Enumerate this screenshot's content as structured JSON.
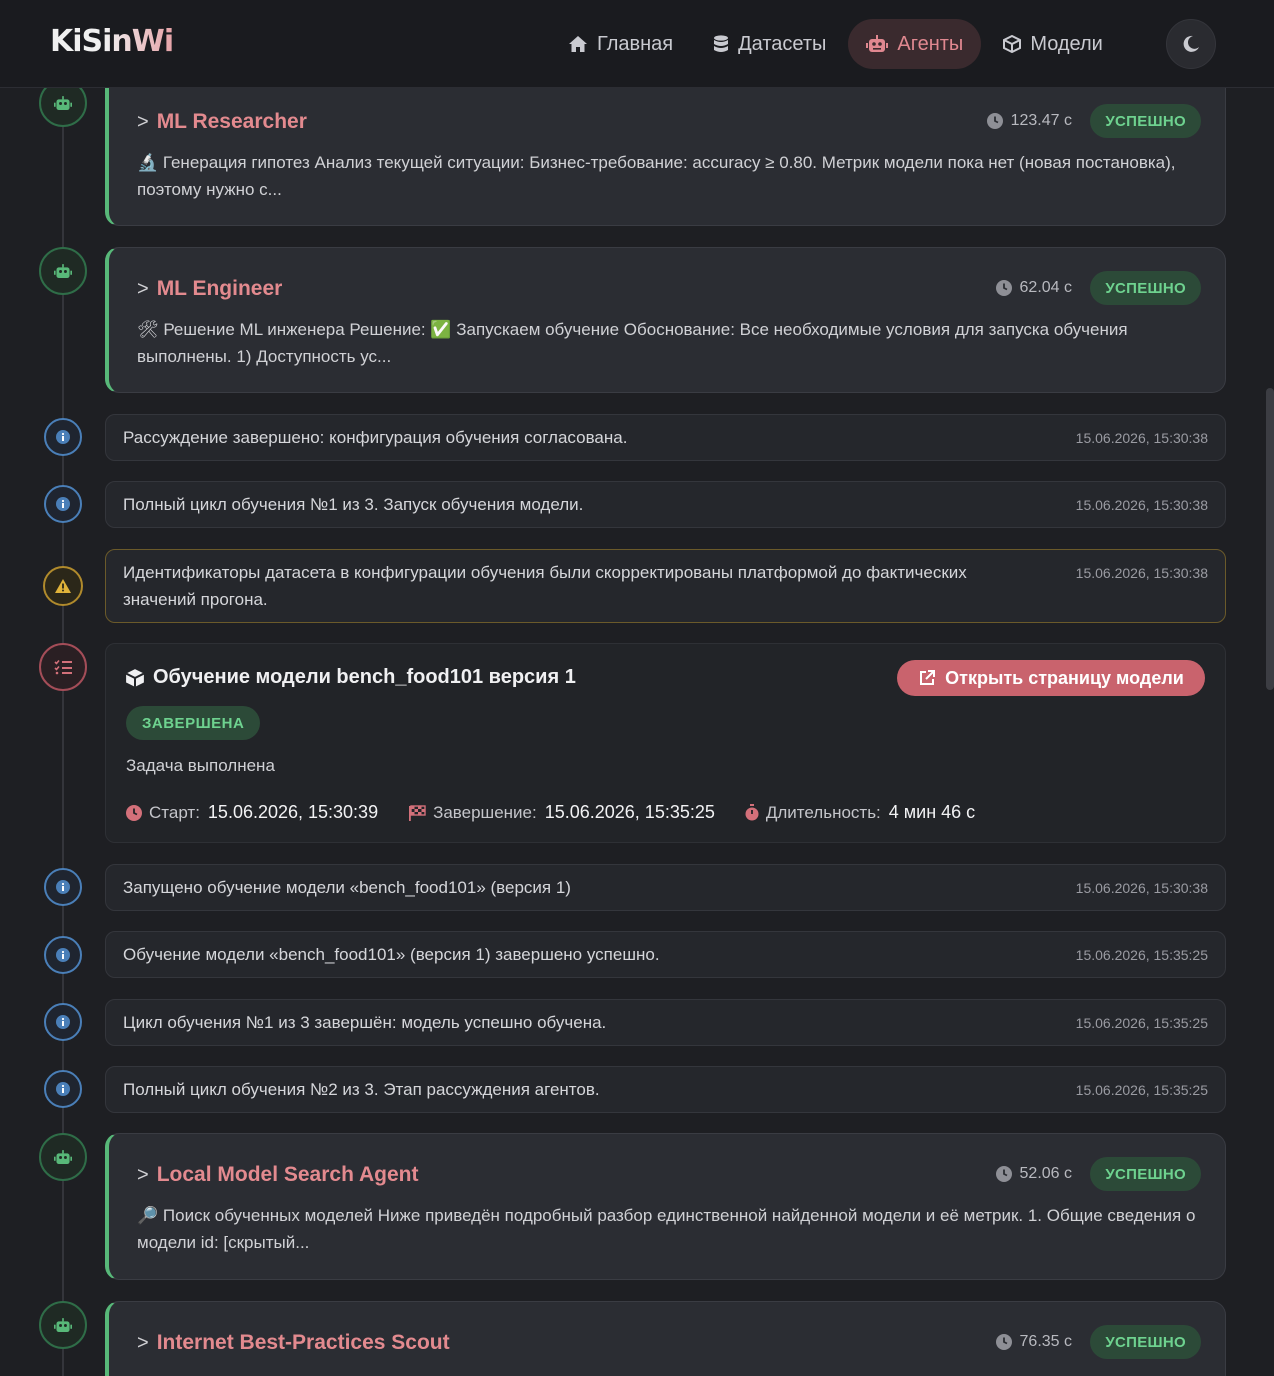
{
  "header": {
    "logo": "KiSinWi",
    "nav": [
      {
        "label": "Главная",
        "icon": "home-icon"
      },
      {
        "label": "Датасеты",
        "icon": "database-icon"
      },
      {
        "label": "Агенты",
        "icon": "robot-icon",
        "active": true
      },
      {
        "label": "Модели",
        "icon": "cube-icon"
      }
    ],
    "theme_icon": "moon-icon"
  },
  "timeline": {
    "agents": [
      {
        "name": "ML Researcher",
        "time": "123.47 с",
        "status": "УСПЕШНО",
        "emoji": "🔬",
        "desc": "Генерация гипотез Анализ текущей ситуации: Бизнес-требование: accuracy ≥ 0.80. Метрик модели пока нет (новая постановка), поэтому нужно с..."
      },
      {
        "name": "ML Engineer",
        "time": "62.04 с",
        "status": "УСПЕШНО",
        "emoji": "🛠",
        "desc": "Решение ML инженера Решение: ✅ Запускаем обучение Обоснование: Все необходимые условия для запуска обучения выполнены. 1) Доступность ус..."
      },
      {
        "name": "Local Model Search Agent",
        "time": "52.06 с",
        "status": "УСПЕШНО",
        "emoji": "🔎",
        "desc": "Поиск обученных моделей Ниже приведён подробный разбор единственной найденной модели и её метрик. 1. Общие сведения о модели id: [скрытый..."
      },
      {
        "name": "Internet Best-Practices Scout",
        "time": "76.35 с",
        "status": "УСПЕШНО"
      }
    ],
    "logs": [
      {
        "text": "Рассуждение завершено: конфигурация обучения согласована.",
        "date": "15.06.2026, 15:30:38"
      },
      {
        "text": "Полный цикл обучения №1 из 3. Запуск обучения модели.",
        "date": "15.06.2026, 15:30:38"
      },
      {
        "text": "Идентификаторы датасета в конфигурации обучения были скорректированы платформой до фактических значений прогона.",
        "date": "15.06.2026, 15:30:38"
      },
      {
        "text": "Запущено обучение модели «bench_food101» (версия 1)",
        "date": "15.06.2026, 15:30:38"
      },
      {
        "text": "Обучение модели «bench_food101» (версия 1) завершено успешно.",
        "date": "15.06.2026, 15:35:25"
      },
      {
        "text": "Цикл обучения №1 из 3 завершён: модель успешно обучена.",
        "date": "15.06.2026, 15:35:25"
      },
      {
        "text": "Полный цикл обучения №2 из 3. Этап рассуждения агентов.",
        "date": "15.06.2026, 15:35:25"
      }
    ],
    "task": {
      "title": "Обучение модели bench_food101 версия 1",
      "open_button": "Открыть страницу модели",
      "status": "ЗАВЕРШЕНА",
      "message": "Задача выполнена",
      "start_label": "Старт:",
      "start_value": "15.06.2026, 15:30:39",
      "end_label": "Завершение:",
      "end_value": "15.06.2026, 15:35:25",
      "duration_label": "Длительность:",
      "duration_value": "4 мин 46 с"
    }
  },
  "colors": {
    "accent": "#e38a8f",
    "success": "#6ed28f",
    "info": "#4a7fb8",
    "warning": "#e0b33a"
  }
}
